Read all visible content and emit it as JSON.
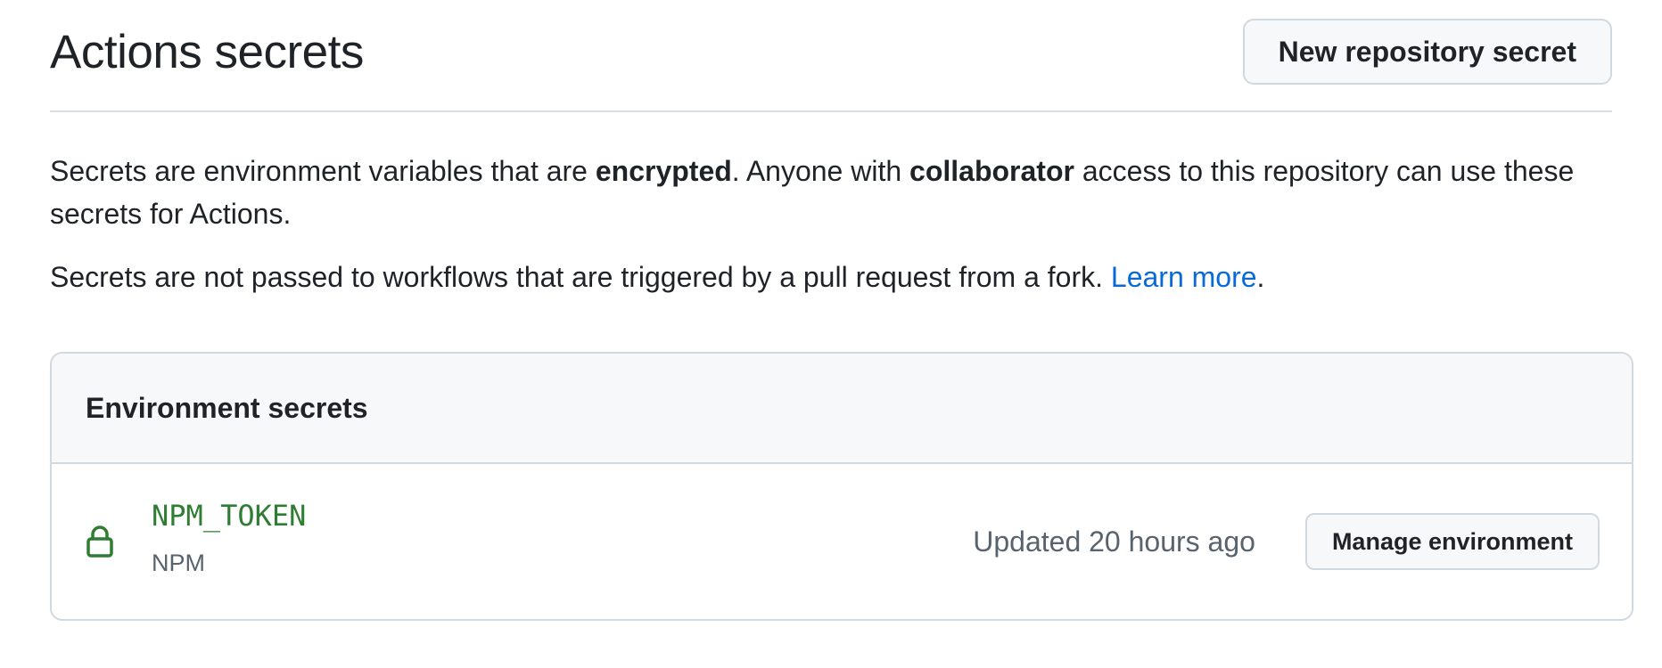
{
  "header": {
    "title": "Actions secrets",
    "new_secret_button": "New repository secret"
  },
  "description": {
    "p1_part1": "Secrets are environment variables that are ",
    "p1_bold1": "encrypted",
    "p1_part2": ". Anyone with ",
    "p1_bold2": "collaborator",
    "p1_part3": " access to this repository can use these secrets for Actions.",
    "p2_text": "Secrets are not passed to workflows that are triggered by a pull request from a fork. ",
    "p2_link": "Learn more",
    "p2_end": "."
  },
  "environment_secrets": {
    "title": "Environment secrets",
    "items": [
      {
        "icon": "lock-icon",
        "name": "NPM_TOKEN",
        "environment": "NPM",
        "updated": "Updated 20 hours ago",
        "manage_button": "Manage environment"
      }
    ]
  },
  "colors": {
    "secret_name": "#2f7d32",
    "link": "#0969da",
    "muted": "#59636e"
  }
}
